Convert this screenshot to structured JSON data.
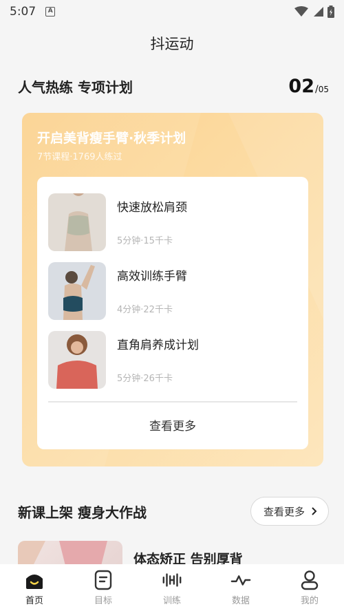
{
  "status_bar": {
    "time": "5:07",
    "notification_icon": "A"
  },
  "app_title": "抖运动",
  "section1": {
    "title": "人气热练 专项计划",
    "page_current": "02",
    "page_separator": "/",
    "page_total": "05"
  },
  "plan": {
    "title": "开启美背瘦手臂·秋季计划",
    "subtitle": "7节课程·1769人练过",
    "courses": [
      {
        "name": "快速放松肩颈",
        "meta": "5分钟·15千卡"
      },
      {
        "name": "高效训练手臂",
        "meta": "4分钟·22千卡"
      },
      {
        "name": "直角肩养成计划",
        "meta": "5分钟·26千卡"
      }
    ],
    "more_label": "查看更多"
  },
  "section2": {
    "title": "新课上架 瘦身大作战",
    "more_label": "查看更多",
    "preview_title": "体态矫正 告别厚背"
  },
  "tabs": [
    {
      "label": "首页",
      "icon": "home-icon"
    },
    {
      "label": "目标",
      "icon": "target-icon"
    },
    {
      "label": "训练",
      "icon": "dumbbell-icon"
    },
    {
      "label": "数据",
      "icon": "chart-icon"
    },
    {
      "label": "我的",
      "icon": "profile-icon"
    }
  ]
}
